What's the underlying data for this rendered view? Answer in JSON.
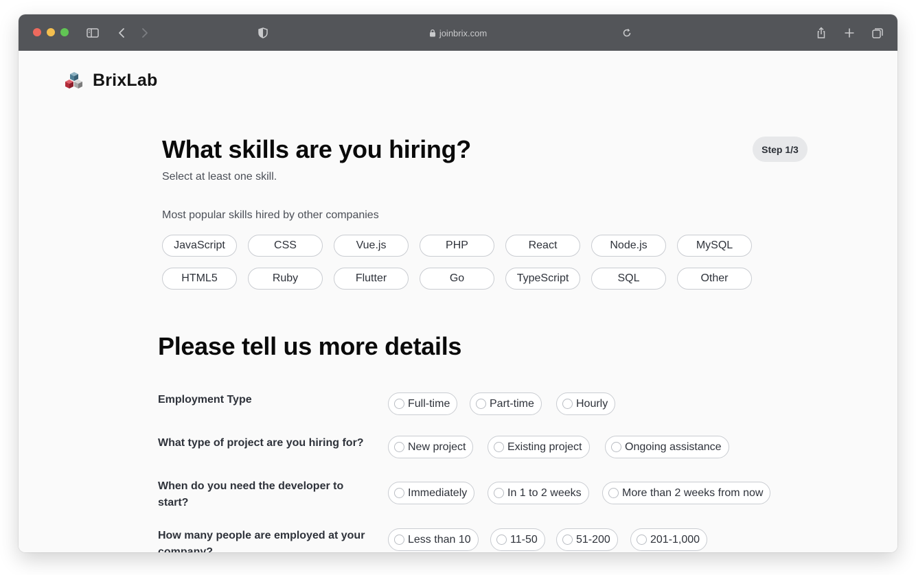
{
  "browser": {
    "url": "joinbrix.com"
  },
  "brand": {
    "name": "BrixLab"
  },
  "skills_section": {
    "title": "What skills are you hiring?",
    "subtitle": "Select at least one skill.",
    "step": "Step 1/3",
    "popular_label": "Most popular skills hired by other companies",
    "skills": [
      "JavaScript",
      "CSS",
      "Vue.js",
      "PHP",
      "React",
      "Node.js",
      "MySQL",
      "HTML5",
      "Ruby",
      "Flutter",
      "Go",
      "TypeScript",
      "SQL",
      "Other"
    ]
  },
  "details_section": {
    "title": "Please tell us more details",
    "questions": [
      {
        "label": "Employment Type",
        "options": [
          "Full-time",
          "Part-time",
          "Hourly"
        ]
      },
      {
        "label": "What type of project are you hiring for?",
        "options": [
          "New project",
          "Existing project",
          "Ongoing assistance"
        ]
      },
      {
        "label": "When do you need the developer to start?",
        "options": [
          "Immediately",
          "In 1 to 2 weeks",
          "More than 2 weeks from now"
        ]
      },
      {
        "label": "How many people are employed at your company?",
        "options": [
          "Less than 10",
          "11-50",
          "51-200",
          "201-1,000"
        ]
      }
    ]
  }
}
